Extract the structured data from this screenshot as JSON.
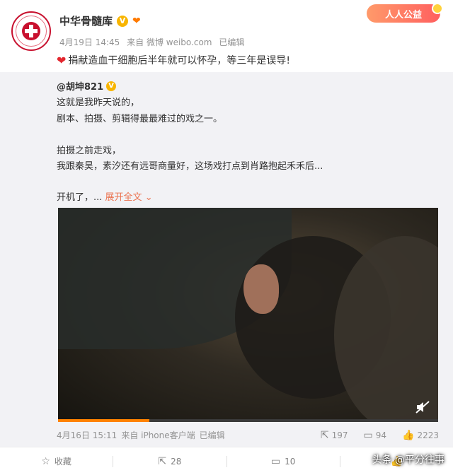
{
  "author": {
    "name": "中华骨髓库",
    "verified_mark": "V",
    "meta": {
      "date": "4月19日 14:45",
      "source": "来自 微博 weibo.com",
      "edited": "已编辑"
    }
  },
  "charity_badge": "人人公益",
  "post": {
    "text": "捐献造血干细胞后半年就可以怀孕，等三年是误导!",
    "heart_color": "#e3262e"
  },
  "repost": {
    "author": "@胡坤821",
    "lines": [
      "这就是我昨天说的，",
      "剧本、拍摄、剪辑得最最难过的戏之一。",
      "拍摄之前走戏，",
      "我跟秦昊，素汐还有远哥商量好，这场戏打点到肖路抱起禾禾后..."
    ],
    "last_line": "开机了，...",
    "expand_label": "展开全文",
    "video": {
      "progress_fraction": 0.24
    },
    "footer": {
      "date": "4月16日 15:11",
      "source": "来自 iPhone客户端",
      "edited": "已编辑",
      "reposts": "197",
      "comments": "94",
      "likes": "2223"
    }
  },
  "actions": {
    "favorite": "收藏",
    "repost": "28",
    "comment": "10"
  },
  "watermark": "头条 @平分往事",
  "colors": {
    "accent": "#ff8200",
    "link": "#eb7350",
    "brand_red": "#c8102e"
  }
}
